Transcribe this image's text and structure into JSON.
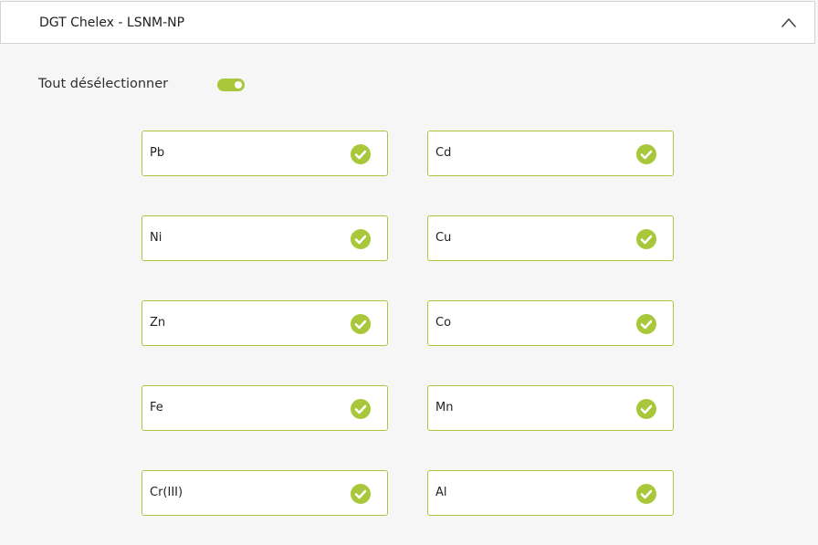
{
  "panel": {
    "title": "DGT Chelex - LSNM-NP"
  },
  "toggle": {
    "label": "Tout désélectionner",
    "state": "on"
  },
  "colors": {
    "accent": "#a9c73a",
    "background": "#f6f6f6"
  },
  "elements": [
    {
      "label": "Pb",
      "checked": true
    },
    {
      "label": "Cd",
      "checked": true
    },
    {
      "label": "Ni",
      "checked": true
    },
    {
      "label": "Cu",
      "checked": true
    },
    {
      "label": "Zn",
      "checked": true
    },
    {
      "label": "Co",
      "checked": true
    },
    {
      "label": "Fe",
      "checked": true
    },
    {
      "label": "Mn",
      "checked": true
    },
    {
      "label": "Cr(III)",
      "checked": true
    },
    {
      "label": "Al",
      "checked": true
    }
  ]
}
